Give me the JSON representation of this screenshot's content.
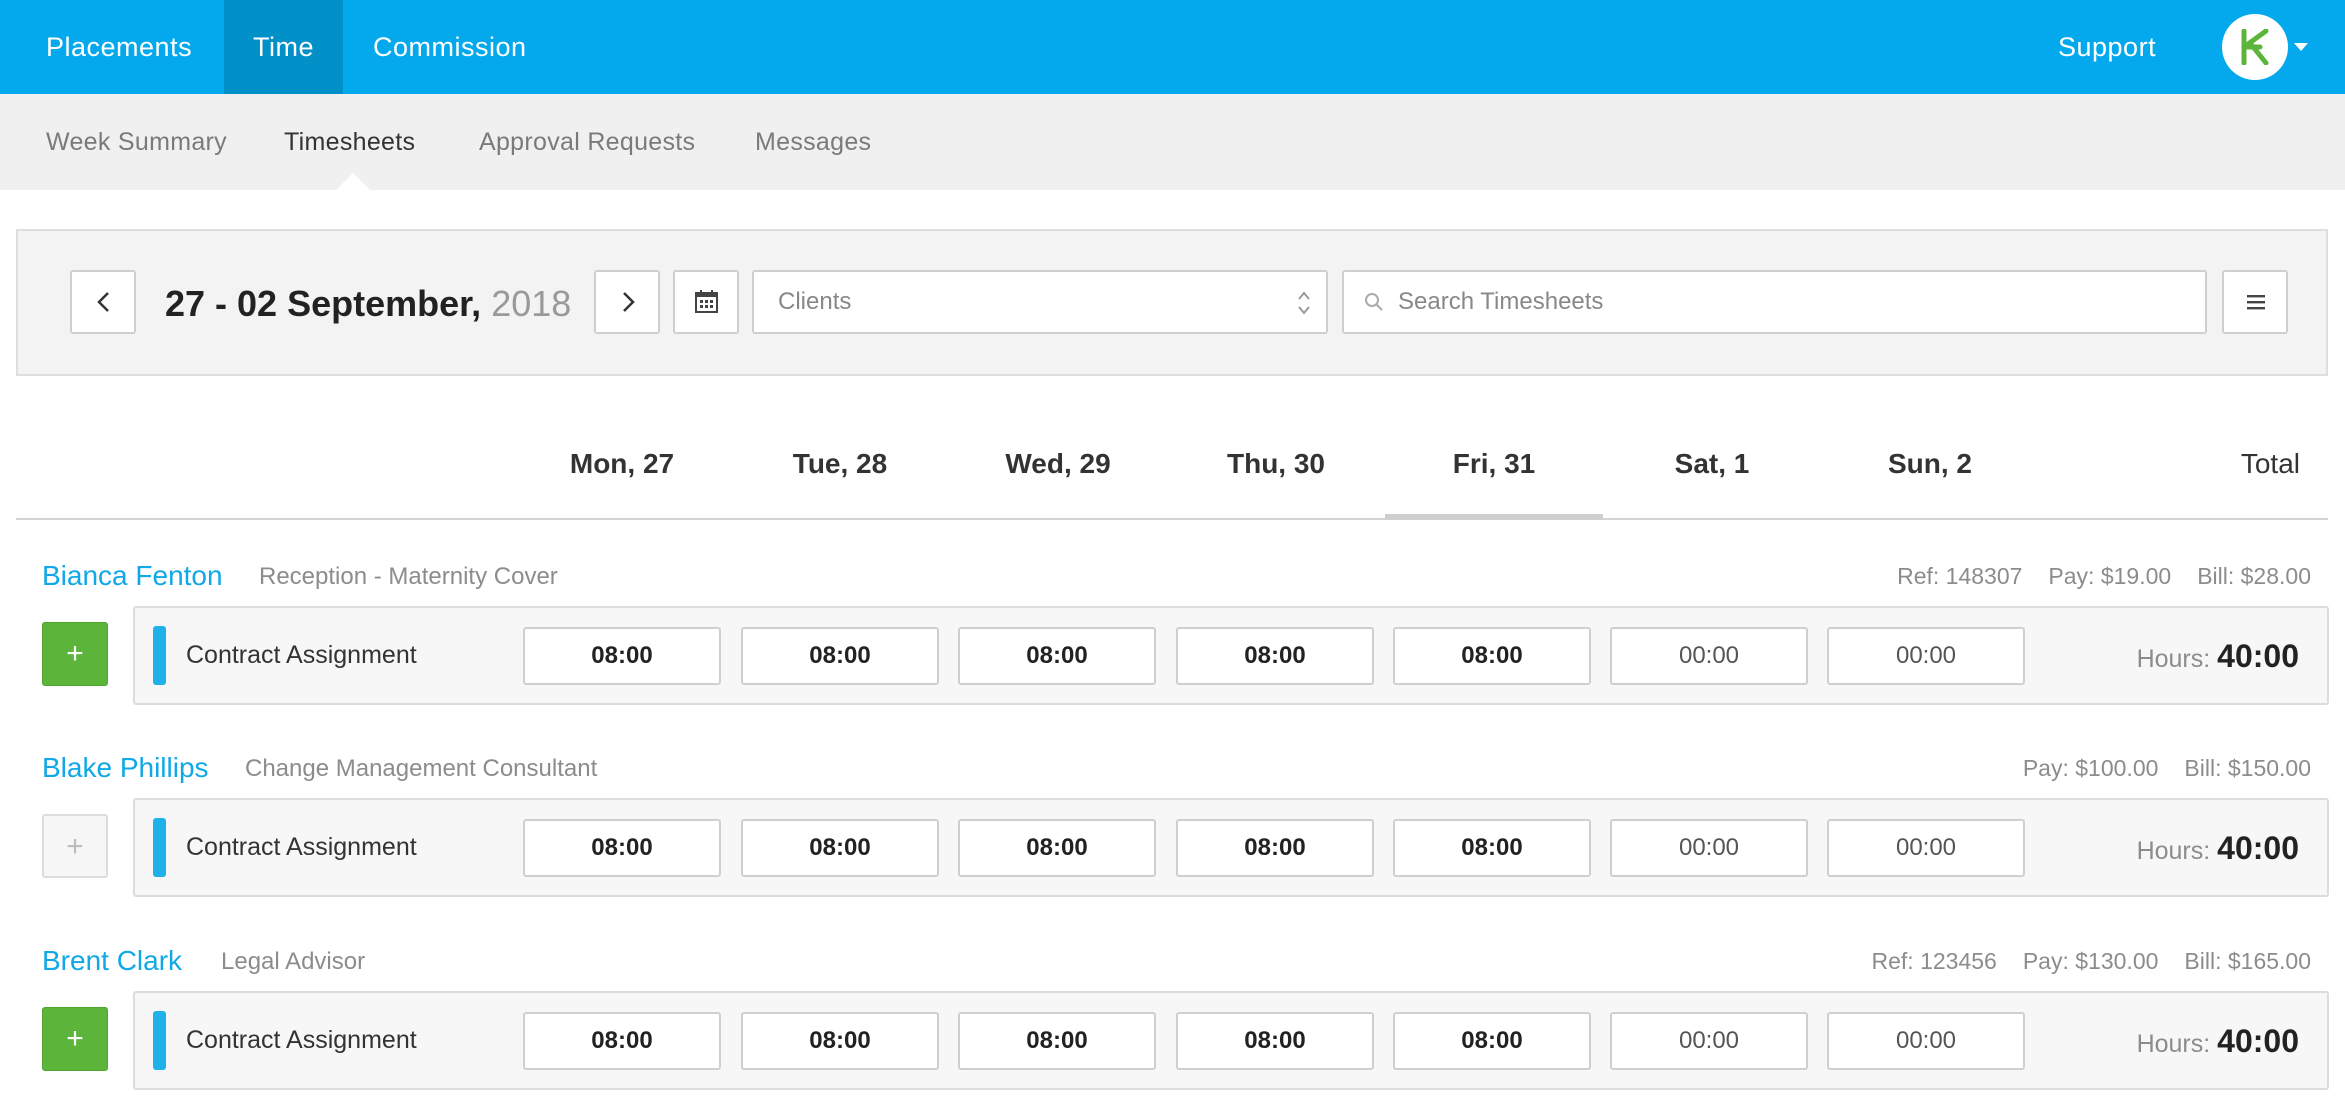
{
  "topnav": {
    "items": [
      {
        "label": "Placements",
        "active": false
      },
      {
        "label": "Time",
        "active": true
      },
      {
        "label": "Commission",
        "active": false
      }
    ],
    "support_label": "Support",
    "brand_color": "#03a9ec"
  },
  "subnav": {
    "items": [
      {
        "label": "Week Summary",
        "active": false
      },
      {
        "label": "Timesheets",
        "active": true
      },
      {
        "label": "Approval Requests",
        "active": false
      },
      {
        "label": "Messages",
        "active": false
      }
    ]
  },
  "toolbar": {
    "week_range": "27 - 02 September,",
    "year": "2018",
    "clients_label": "Clients",
    "search_placeholder": "Search Timesheets"
  },
  "days": [
    "Mon, 27",
    "Tue, 28",
    "Wed, 29",
    "Thu, 30",
    "Fri, 31",
    "Sat, 1",
    "Sun, 2"
  ],
  "active_day": "Fri, 31",
  "total_label": "Total",
  "rows": [
    {
      "name": "Bianca Fenton",
      "role": "Reception - Maternity Cover",
      "ref": "Ref: 148307",
      "pay": "Pay: $19.00",
      "bill_label": "Bill:",
      "bill_value": "$28.00",
      "add_enabled": true,
      "assignment": "Contract Assignment",
      "times": [
        "08:00",
        "08:00",
        "08:00",
        "08:00",
        "08:00",
        "00:00",
        "00:00"
      ],
      "hours_label": "Hours:",
      "hours_value": "40:00"
    },
    {
      "name": "Blake Phillips",
      "role": "Change Management Consultant",
      "ref": "",
      "pay": "Pay: $100.00",
      "bill_label": "Bill:",
      "bill_value": "$150.00",
      "add_enabled": false,
      "assignment": "Contract Assignment",
      "times": [
        "08:00",
        "08:00",
        "08:00",
        "08:00",
        "08:00",
        "00:00",
        "00:00"
      ],
      "hours_label": "Hours:",
      "hours_value": "40:00"
    },
    {
      "name": "Brent Clark",
      "role": "Legal Advisor",
      "ref": "Ref: 123456",
      "pay": "Pay: $130.00",
      "bill_label": "Bill:",
      "bill_value": "$165.00",
      "add_enabled": true,
      "assignment": "Contract Assignment",
      "times": [
        "08:00",
        "08:00",
        "08:00",
        "08:00",
        "08:00",
        "00:00",
        "00:00"
      ],
      "hours_label": "Hours:",
      "hours_value": "40:00"
    }
  ],
  "icons": {
    "prev": "chevron-left-icon",
    "next": "chevron-right-icon",
    "calendar": "calendar-icon",
    "search": "search-icon",
    "menu": "hamburger-menu-icon",
    "select": "select-arrows-icon",
    "add": "plus-icon"
  },
  "colors": {
    "accent": "#10a8e6",
    "add_button": "#5cb53a",
    "stripe": "#1fb1ea"
  }
}
